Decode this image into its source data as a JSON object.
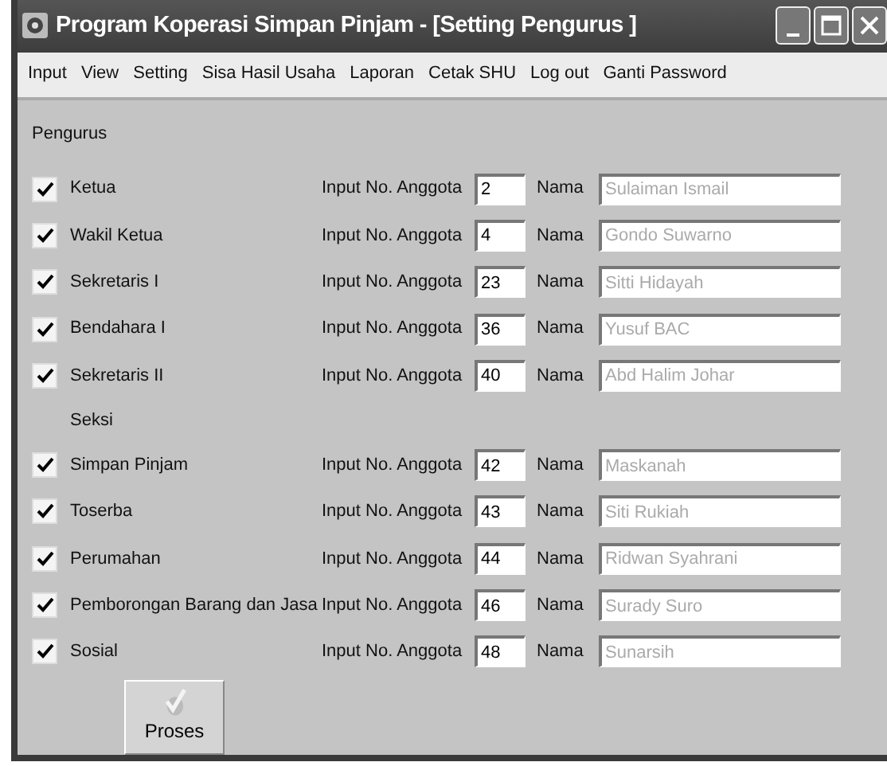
{
  "window": {
    "title": "Program Koperasi Simpan Pinjam - [Setting Pengurus ]"
  },
  "menu": [
    "Input",
    "View",
    "Setting",
    "Sisa Hasil Usaha",
    "Laporan",
    "Cetak SHU",
    "Log out",
    "Ganti Password"
  ],
  "group_title": "Pengurus",
  "sections": [
    {
      "rows": [
        {
          "label": "Ketua",
          "checked": true,
          "no_label": "Input No. Anggota",
          "no": "2",
          "name_label": "Nama",
          "name": "Sulaiman Ismail",
          "name_disabled": true
        },
        {
          "label": "Wakil Ketua",
          "checked": true,
          "no_label": "Input No. Anggota",
          "no": "4",
          "name_label": "Nama",
          "name": "Gondo Suwarno",
          "name_disabled": true
        },
        {
          "label": "Sekretaris I",
          "checked": true,
          "no_label": "Input No. Anggota",
          "no": "23",
          "name_label": "Nama",
          "name": "Sitti Hidayah",
          "name_disabled": true
        },
        {
          "label": "Bendahara I",
          "checked": true,
          "no_label": "Input No. Anggota",
          "no": "36",
          "name_label": "Nama",
          "name": "Yusuf BAC",
          "name_disabled": true
        },
        {
          "label": "Sekretaris II",
          "checked": true,
          "no_label": "Input No. Anggota",
          "no": "40",
          "name_label": "Nama",
          "name": "Abd Halim Johar",
          "name_disabled": true
        }
      ]
    },
    {
      "title": "Seksi",
      "rows": [
        {
          "label": "Simpan Pinjam",
          "checked": true,
          "no_label": "Input No. Anggota",
          "no": "42",
          "name_label": "Nama",
          "name": "Maskanah",
          "name_disabled": true
        },
        {
          "label": "Toserba",
          "checked": true,
          "no_label": "Input No. Anggota",
          "no": "43",
          "name_label": "Nama",
          "name": "Siti Rukiah",
          "name_disabled": true
        },
        {
          "label": "Perumahan",
          "checked": true,
          "no_label": "Input No. Anggota",
          "no": "44",
          "name_label": "Nama",
          "name": "Ridwan Syahrani",
          "name_disabled": true
        },
        {
          "label": "Pemborongan Barang dan Jasa",
          "checked": true,
          "no_label": "Input No. Anggota",
          "no": "46",
          "name_label": "Nama",
          "name": "Surady Suro",
          "name_disabled": true
        },
        {
          "label": "Sosial",
          "checked": true,
          "no_label": "Input No. Anggota",
          "no": "48",
          "name_label": "Nama",
          "name": "Sunarsih",
          "name_disabled": true
        }
      ]
    }
  ],
  "button": "Proses"
}
